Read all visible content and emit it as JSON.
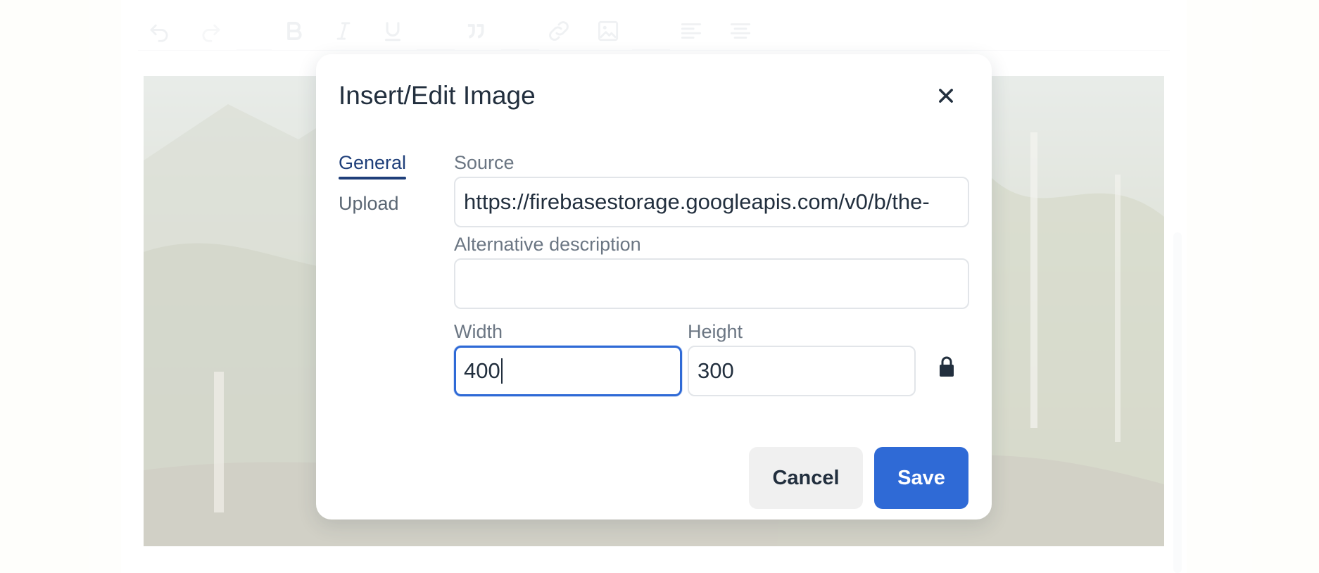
{
  "colors": {
    "page_bg": "#fbfbf2",
    "accent": "#2f6ad6",
    "tab_active": "#1f3f7a",
    "text": "#222f3e"
  },
  "toolbar": {
    "buttons": [
      "undo-icon",
      "redo-icon",
      "bold-icon",
      "italic-icon",
      "underline-icon",
      "blockquote-icon",
      "link-icon",
      "image-icon",
      "align-left-icon",
      "align-center-icon"
    ]
  },
  "dialog": {
    "title": "Insert/Edit Image",
    "tabs": [
      {
        "label": "General",
        "active": true
      },
      {
        "label": "Upload",
        "active": false
      }
    ],
    "source": {
      "label": "Source",
      "value": "https://firebasestorage.googleapis.com/v0/b/the-"
    },
    "alt": {
      "label": "Alternative description",
      "value": ""
    },
    "width": {
      "label": "Width",
      "value": "400"
    },
    "height": {
      "label": "Height",
      "value": "300"
    },
    "buttons": {
      "cancel": "Cancel",
      "save": "Save"
    }
  }
}
